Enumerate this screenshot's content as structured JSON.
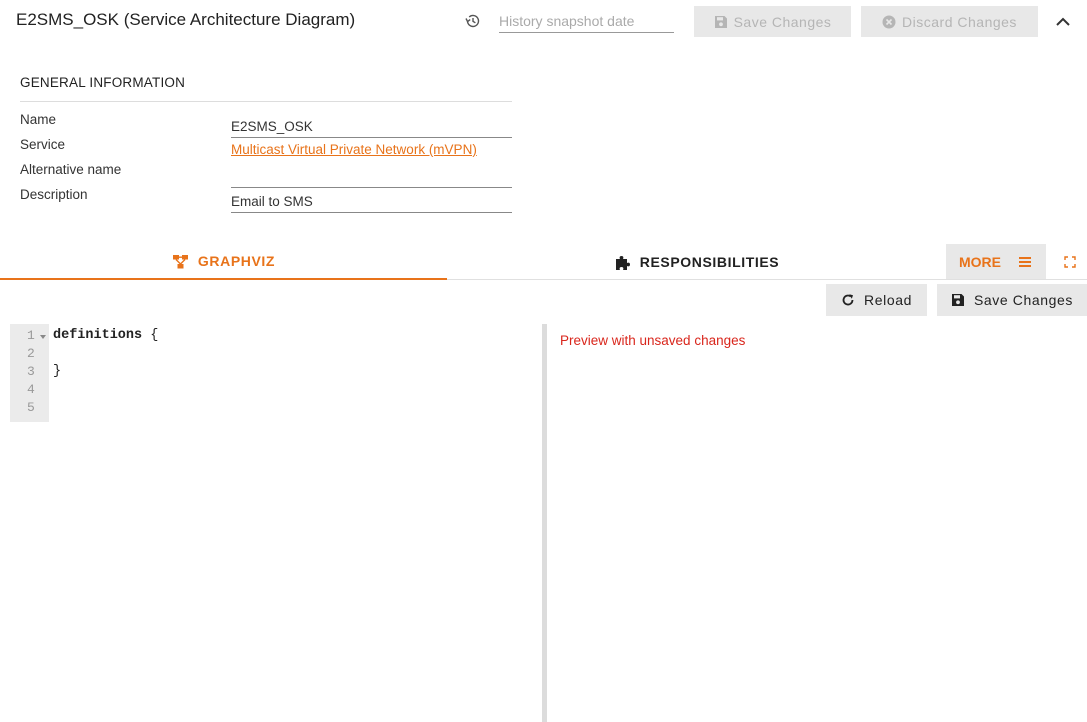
{
  "header": {
    "title": "E2SMS_OSK (Service Architecture Diagram)",
    "history_placeholder": "History snapshot date",
    "save_label": "Save Changes",
    "discard_label": "Discard Changes"
  },
  "general": {
    "section_title": "GENERAL INFORMATION",
    "fields": [
      {
        "label": "Name",
        "value": "E2SMS_OSK"
      },
      {
        "label": "Service",
        "value": "Multicast Virtual Private Network (mVPN)"
      },
      {
        "label": "Alternative name",
        "value": ""
      },
      {
        "label": "Description",
        "value": "Email to SMS"
      }
    ]
  },
  "tabs": [
    {
      "label": "GRAPHVIZ",
      "icon": "sitemap-icon",
      "active": true
    },
    {
      "label": "RESPONSIBILITIES",
      "icon": "puzzle-icon",
      "active": false
    }
  ],
  "more": {
    "label": "MORE",
    "icon": "menu-icon"
  },
  "actions": {
    "reload_label": "Reload",
    "save_label": "Save Changes"
  },
  "editor": {
    "line_numbers": [
      "1",
      "2",
      "3",
      "4",
      "5"
    ],
    "lines": [
      {
        "keyword": "definitions",
        "rest": " {"
      },
      {
        "keyword": "",
        "rest": ""
      },
      {
        "keyword": "",
        "rest": "}"
      },
      {
        "keyword": "",
        "rest": ""
      },
      {
        "keyword": "",
        "rest": ""
      }
    ]
  },
  "preview": {
    "note": "Preview with unsaved changes"
  },
  "colors": {
    "accent": "#e8731a",
    "warning": "#d9261c",
    "button_bg": "#e8e8e8"
  }
}
